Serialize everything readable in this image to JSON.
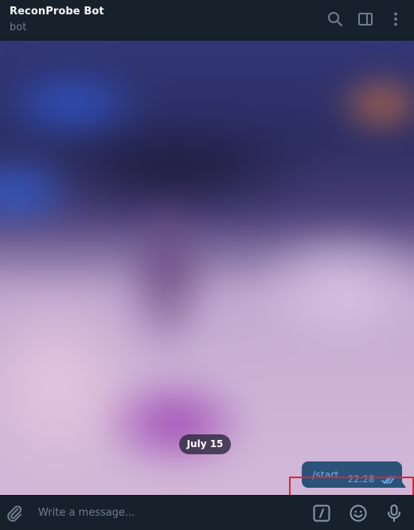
{
  "header": {
    "title": "ReconProbe Bot",
    "subtitle": "bot",
    "icons": [
      "search-icon",
      "sidebar-toggle-icon",
      "more-vertical-icon"
    ]
  },
  "chat": {
    "date_separator": "July 15",
    "messages": [
      {
        "text": "/start",
        "time": "22:28",
        "outgoing": true,
        "status": "read"
      }
    ]
  },
  "composer": {
    "placeholder": "Write a message...",
    "icons": [
      "attach-icon",
      "bot-commands-icon",
      "emoji-icon",
      "microphone-icon"
    ]
  },
  "colors": {
    "background": "#17212b",
    "outgoing_bubble": "#2b5278",
    "link_text": "#6ab3f3",
    "highlight": "#e8202b",
    "icon": "#6d7f8f"
  }
}
